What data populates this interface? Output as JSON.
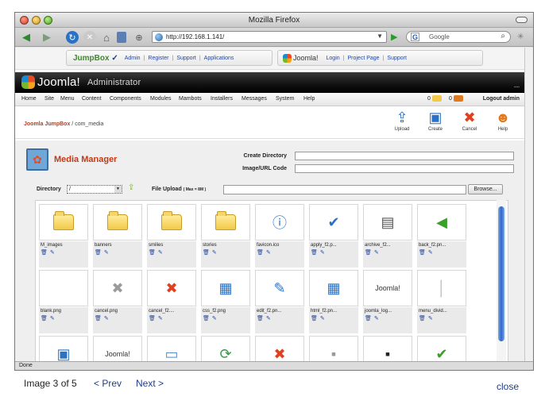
{
  "browser": {
    "title": "Mozilla Firefox",
    "url": "http://192.168.1.141/",
    "search_placeholder": "Google",
    "search_engine_glyph": "G",
    "status": "Done"
  },
  "jumpbox_bar": {
    "brand": "JumpBox",
    "links": [
      "Admin",
      "Register",
      "Support",
      "Applications"
    ],
    "joomla_brand": "Joomla!",
    "joomla_links": [
      "Login",
      "Project Page",
      "Support"
    ]
  },
  "admin": {
    "logo": "Joomla!",
    "subtitle": "Administrator",
    "menu": [
      "Home",
      "Site",
      "Menu",
      "Content",
      "Components",
      "Modules",
      "Mambots",
      "Installers",
      "Messages",
      "System",
      "Help"
    ],
    "msg_count_1": "0",
    "msg_count_2": "0",
    "logout": "Logout admin"
  },
  "breadcrumb": {
    "site": "Joomla JumpBox",
    "path": " / com_media"
  },
  "toolbar": [
    {
      "label": "Upload",
      "icon": "upload-icon",
      "glyph": "⇪",
      "color": "#2a72c6"
    },
    {
      "label": "Create",
      "icon": "create-icon",
      "glyph": "▣",
      "color": "#2a72c6"
    },
    {
      "label": "Cancel",
      "icon": "cancel-icon",
      "glyph": "✖",
      "color": "#e0401e"
    },
    {
      "label": "Help",
      "icon": "help-icon",
      "glyph": "☻",
      "color": "#e07a1e"
    }
  ],
  "media": {
    "title": "Media Manager",
    "create_dir_label": "Create Directory",
    "image_url_label": "Image/URL Code",
    "directory_label": "Directory",
    "directory_value": "/",
    "upload_label": "File Upload",
    "upload_note": "( Max = 8M )",
    "browse_label": "Browse...",
    "files": [
      {
        "name": "M_images",
        "kind": "folder",
        "glyph": ""
      },
      {
        "name": "banners",
        "kind": "folder",
        "glyph": ""
      },
      {
        "name": "smilies",
        "kind": "folder",
        "glyph": ""
      },
      {
        "name": "stories",
        "kind": "folder",
        "glyph": ""
      },
      {
        "name": "favicon.ico",
        "kind": "image",
        "glyph": "ⓘ",
        "color": "#2a72c6"
      },
      {
        "name": "apply_f2.p...",
        "kind": "image",
        "glyph": "✔",
        "color": "#2a72c6"
      },
      {
        "name": "archive_f2...",
        "kind": "image",
        "glyph": "▤",
        "color": "#555555"
      },
      {
        "name": "back_f2.pn...",
        "kind": "image",
        "glyph": "◀",
        "color": "#3aa02a"
      },
      {
        "name": "blank.png",
        "kind": "image",
        "glyph": "",
        "color": "#ffffff"
      },
      {
        "name": "cancel.png",
        "kind": "image",
        "glyph": "✖",
        "color": "#9a9a9a"
      },
      {
        "name": "cancel_f2....",
        "kind": "image",
        "glyph": "✖",
        "color": "#e0401e"
      },
      {
        "name": "css_f2.png",
        "kind": "image",
        "glyph": "▦",
        "color": "#2a72c6"
      },
      {
        "name": "edit_f2.pn...",
        "kind": "image",
        "glyph": "✎",
        "color": "#2a72c6"
      },
      {
        "name": "html_f2.pn...",
        "kind": "image",
        "glyph": "▦",
        "color": "#2a72c6"
      },
      {
        "name": "joomla_log...",
        "kind": "logo",
        "glyph": "Joomla!",
        "color": "#333333"
      },
      {
        "name": "menu_divid...",
        "kind": "image",
        "glyph": "│",
        "color": "#bbbbbb"
      },
      {
        "name": "",
        "kind": "image",
        "glyph": "▣",
        "color": "#2a72c6"
      },
      {
        "name": "",
        "kind": "logo",
        "glyph": "Joomla!",
        "color": "#333333"
      },
      {
        "name": "",
        "kind": "image",
        "glyph": "▭",
        "color": "#5a8ad0"
      },
      {
        "name": "",
        "kind": "image",
        "glyph": "⟳",
        "color": "#3a9a4a"
      },
      {
        "name": "",
        "kind": "image",
        "glyph": "✖",
        "color": "#e0401e"
      },
      {
        "name": "",
        "kind": "image",
        "glyph": "▪",
        "color": "#999999"
      },
      {
        "name": "",
        "kind": "image",
        "glyph": "▪",
        "color": "#222222"
      },
      {
        "name": "",
        "kind": "image",
        "glyph": "✔",
        "color": "#3aa02a"
      }
    ]
  },
  "lightbox": {
    "caption": "Image 3 of 5",
    "prev": "< Prev",
    "next": "Next >",
    "close": "close"
  },
  "colors": {
    "accent_red": "#c23a14",
    "link_blue": "#2346a0"
  }
}
